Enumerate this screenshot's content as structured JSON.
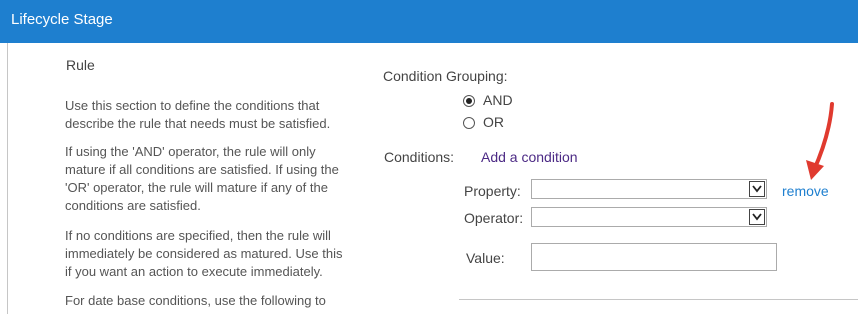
{
  "header": {
    "title": "Lifecycle Stage",
    "background": "#1e7fcf"
  },
  "section": {
    "title": "Rule",
    "paragraphs": [
      [
        "Use this section to define the conditions that",
        "describe the rule that needs must be satisfied."
      ],
      [
        "If using the 'AND' operator, the rule will only",
        "mature if all conditions are satisfied. If using the",
        "'OR' operator, the rule will mature if any of the",
        "conditions are satisfied."
      ],
      [
        "If no conditions are specified, then the rule will",
        "immediately be considered as matured. Use this",
        "if you want an action to execute immediately."
      ],
      [
        "For date base conditions, use the following to"
      ]
    ]
  },
  "grouping": {
    "label": "Condition Grouping:",
    "options": [
      {
        "label": "AND",
        "checked": true
      },
      {
        "label": "OR",
        "checked": false
      }
    ]
  },
  "conditions": {
    "label": "Conditions:",
    "add_link": "Add a condition",
    "link_color": "#4c2a85",
    "remove_link": "remove",
    "remove_color": "#1e7fcf",
    "property_label": "Property:",
    "property_value": "",
    "operator_label": "Operator:",
    "operator_value": "",
    "value_label": "Value:",
    "value_value": ""
  },
  "annotation": {
    "arrow_color": "#e03a2f",
    "arrow_icon": "red-arrow-icon"
  }
}
